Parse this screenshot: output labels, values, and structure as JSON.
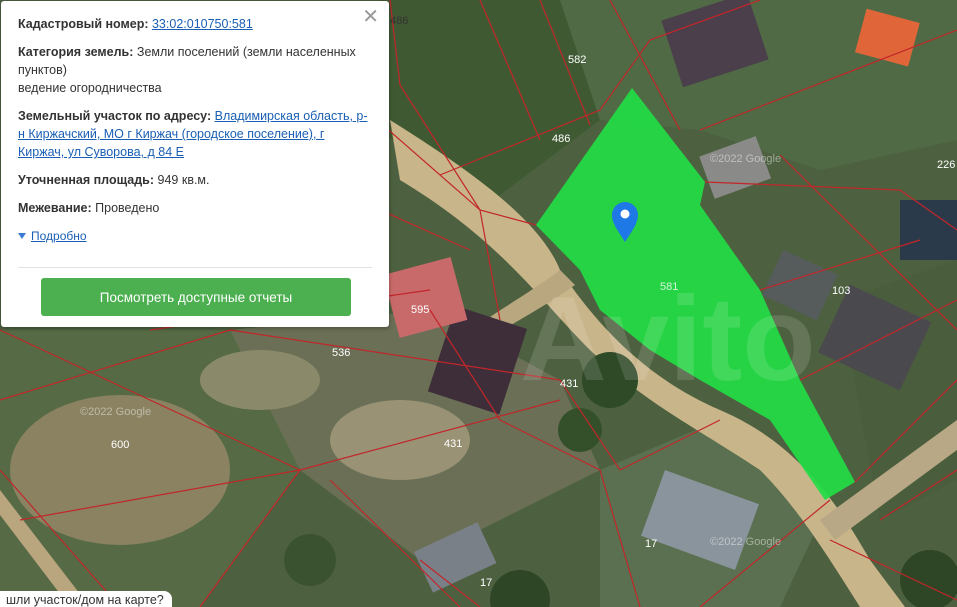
{
  "map": {
    "parcels": [
      {
        "id": "p486a",
        "label": "486"
      },
      {
        "id": "p582",
        "label": "582"
      },
      {
        "id": "p486b",
        "label": "486"
      },
      {
        "id": "p226",
        "label": "226"
      },
      {
        "id": "p581",
        "label": "581"
      },
      {
        "id": "p103",
        "label": "103"
      },
      {
        "id": "p595",
        "label": "595"
      },
      {
        "id": "p536",
        "label": "536"
      },
      {
        "id": "p431a",
        "label": "431"
      },
      {
        "id": "p431b",
        "label": "431"
      },
      {
        "id": "p600",
        "label": "600"
      },
      {
        "id": "p17a",
        "label": "17"
      },
      {
        "id": "p17b",
        "label": "17"
      }
    ],
    "watermark": "Avito",
    "google_marks": [
      "©2022 Google",
      "©2022 Google",
      "©2022 Google"
    ],
    "highlight_color": "#22dd44",
    "marker_icon": "map-pin-icon"
  },
  "popup": {
    "cadastral_label": "Кадастровый номер:",
    "cadastral_value": "33:02:010750:581",
    "category_label": "Категория земель:",
    "category_value": "Земли поселений (земли населенных пунктов)",
    "category_use": "ведение огородничества",
    "address_label": "Земельный участок по адресу:",
    "address_value": "Владимирская область, р-н Киржачский, МО г Киржач (городское поселение), г Киржач, ул Суворова, д 84 Е",
    "area_label": "Уточненная площадь:",
    "area_value": "949 кв.м.",
    "survey_label": "Межевание:",
    "survey_value": "Проведено",
    "more_label": "Подробно",
    "button_label": "Посмотреть доступные отчеты",
    "close_symbol": "✕"
  },
  "bottom_hint": "шли участок/дом на карте?"
}
